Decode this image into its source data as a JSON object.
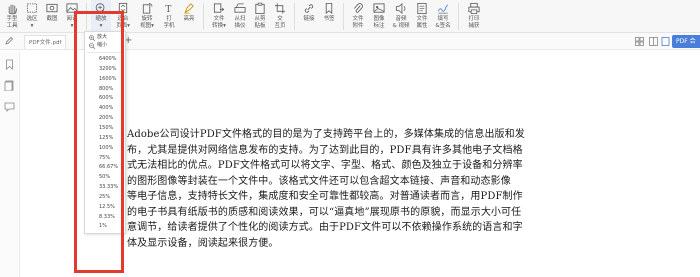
{
  "toolbar": {
    "tools": [
      {
        "name": "hand-tool",
        "label": "手型\n工具",
        "icon": "hand-icon"
      },
      {
        "name": "select-tool",
        "label": "选区\n▾",
        "icon": "select-icon"
      },
      {
        "name": "screenshot-tool",
        "label": "截图",
        "icon": "screenshot-icon"
      },
      {
        "name": "background-tool",
        "label": "阅读\n▾",
        "icon": "image-icon"
      },
      {
        "name": "zoom-tool",
        "label": "缩放\n▾",
        "icon": "zoom-icon"
      },
      {
        "name": "fit-page-tool",
        "label": "适合\n页面▾",
        "icon": "fit-page-icon"
      },
      {
        "name": "rotate-tool",
        "label": "旋转\n视图▾",
        "icon": "rotate-icon"
      },
      {
        "name": "typewriter-tool",
        "label": "打\n字机",
        "icon": "typewriter-icon"
      },
      {
        "name": "highlight-tool",
        "label": "高亮",
        "icon": "highlight-icon"
      },
      {
        "name": "convert-tool",
        "label": "文件\n转换▾",
        "icon": "convert-icon"
      },
      {
        "name": "from-scanner-tool",
        "label": "从扫\n描仪",
        "icon": "scanner-icon"
      },
      {
        "name": "from-file-tool",
        "label": "从剪\n贴板",
        "icon": "clipboard-icon"
      },
      {
        "name": "crop-tool",
        "label": "交\n互页",
        "icon": "crop-icon"
      },
      {
        "name": "link-tool",
        "label": "链接",
        "icon": "link-icon"
      },
      {
        "name": "bookmark-tool",
        "label": "书签",
        "icon": "bookmark-icon"
      },
      {
        "name": "attach-tool",
        "label": "文件\n附件",
        "icon": "attach-icon"
      },
      {
        "name": "image-annot-tool",
        "label": "图像\n标注",
        "icon": "image-annot-icon"
      },
      {
        "name": "sound-tool",
        "label": "音频\n& 视频",
        "icon": "audio-icon"
      },
      {
        "name": "properties-tool",
        "label": "文件\n属性",
        "icon": "properties-icon"
      },
      {
        "name": "fill-sign-tool",
        "label": "填写\n&签名",
        "icon": "sign-icon"
      },
      {
        "name": "print-tool",
        "label": "打印\n捕获",
        "icon": "print-icon"
      }
    ]
  },
  "tabs": {
    "document_tab": "PDF文件.pdf",
    "add_tab": "+",
    "pdf_to_button": "PDF 合"
  },
  "zoom_menu": {
    "zoom_in_label": "放大",
    "zoom_out_label": "缩小",
    "levels": [
      "6400%",
      "3200%",
      "1600%",
      "800%",
      "600%",
      "400%",
      "200%",
      "150%",
      "125%",
      "100%",
      "75%",
      "66.67%",
      "50%",
      "33.33%",
      "25%",
      "12.5%",
      "8.33%",
      "1%"
    ]
  },
  "document": {
    "lines": [
      "Adobe公司设计PDF文件格式的目的是为了支持跨平台上的，多媒体集成的信息出版和发",
      "布，尤其是提供对网络信息发布的支持。为了达到此目的，PDF具有许多其他电子文档格",
      "式无法相比的优点。PDF文件格式可以将文字、字型、格式、颜色及独立于设备和分辨率",
      "的图形图像等封装在一个文件中。该格式文件还可以包含超文本链接、声音和动态影像",
      "等电子信息，支持特长文件，集成度和安全可靠性都较高。对普通读者而言，用PDF制作",
      "的电子书具有纸版书的质感和阅读效果，可以“逼真地”展现原书的原貌，而显示大小可任",
      "意调节，给读者提供了个性化的阅读方式。由于PDF文件可以不依赖操作系统的语言和字",
      "体及显示设备，阅读起来很方便。"
    ]
  },
  "colors": {
    "highlight": "#e23b2e",
    "accent": "#4a7fd9"
  }
}
